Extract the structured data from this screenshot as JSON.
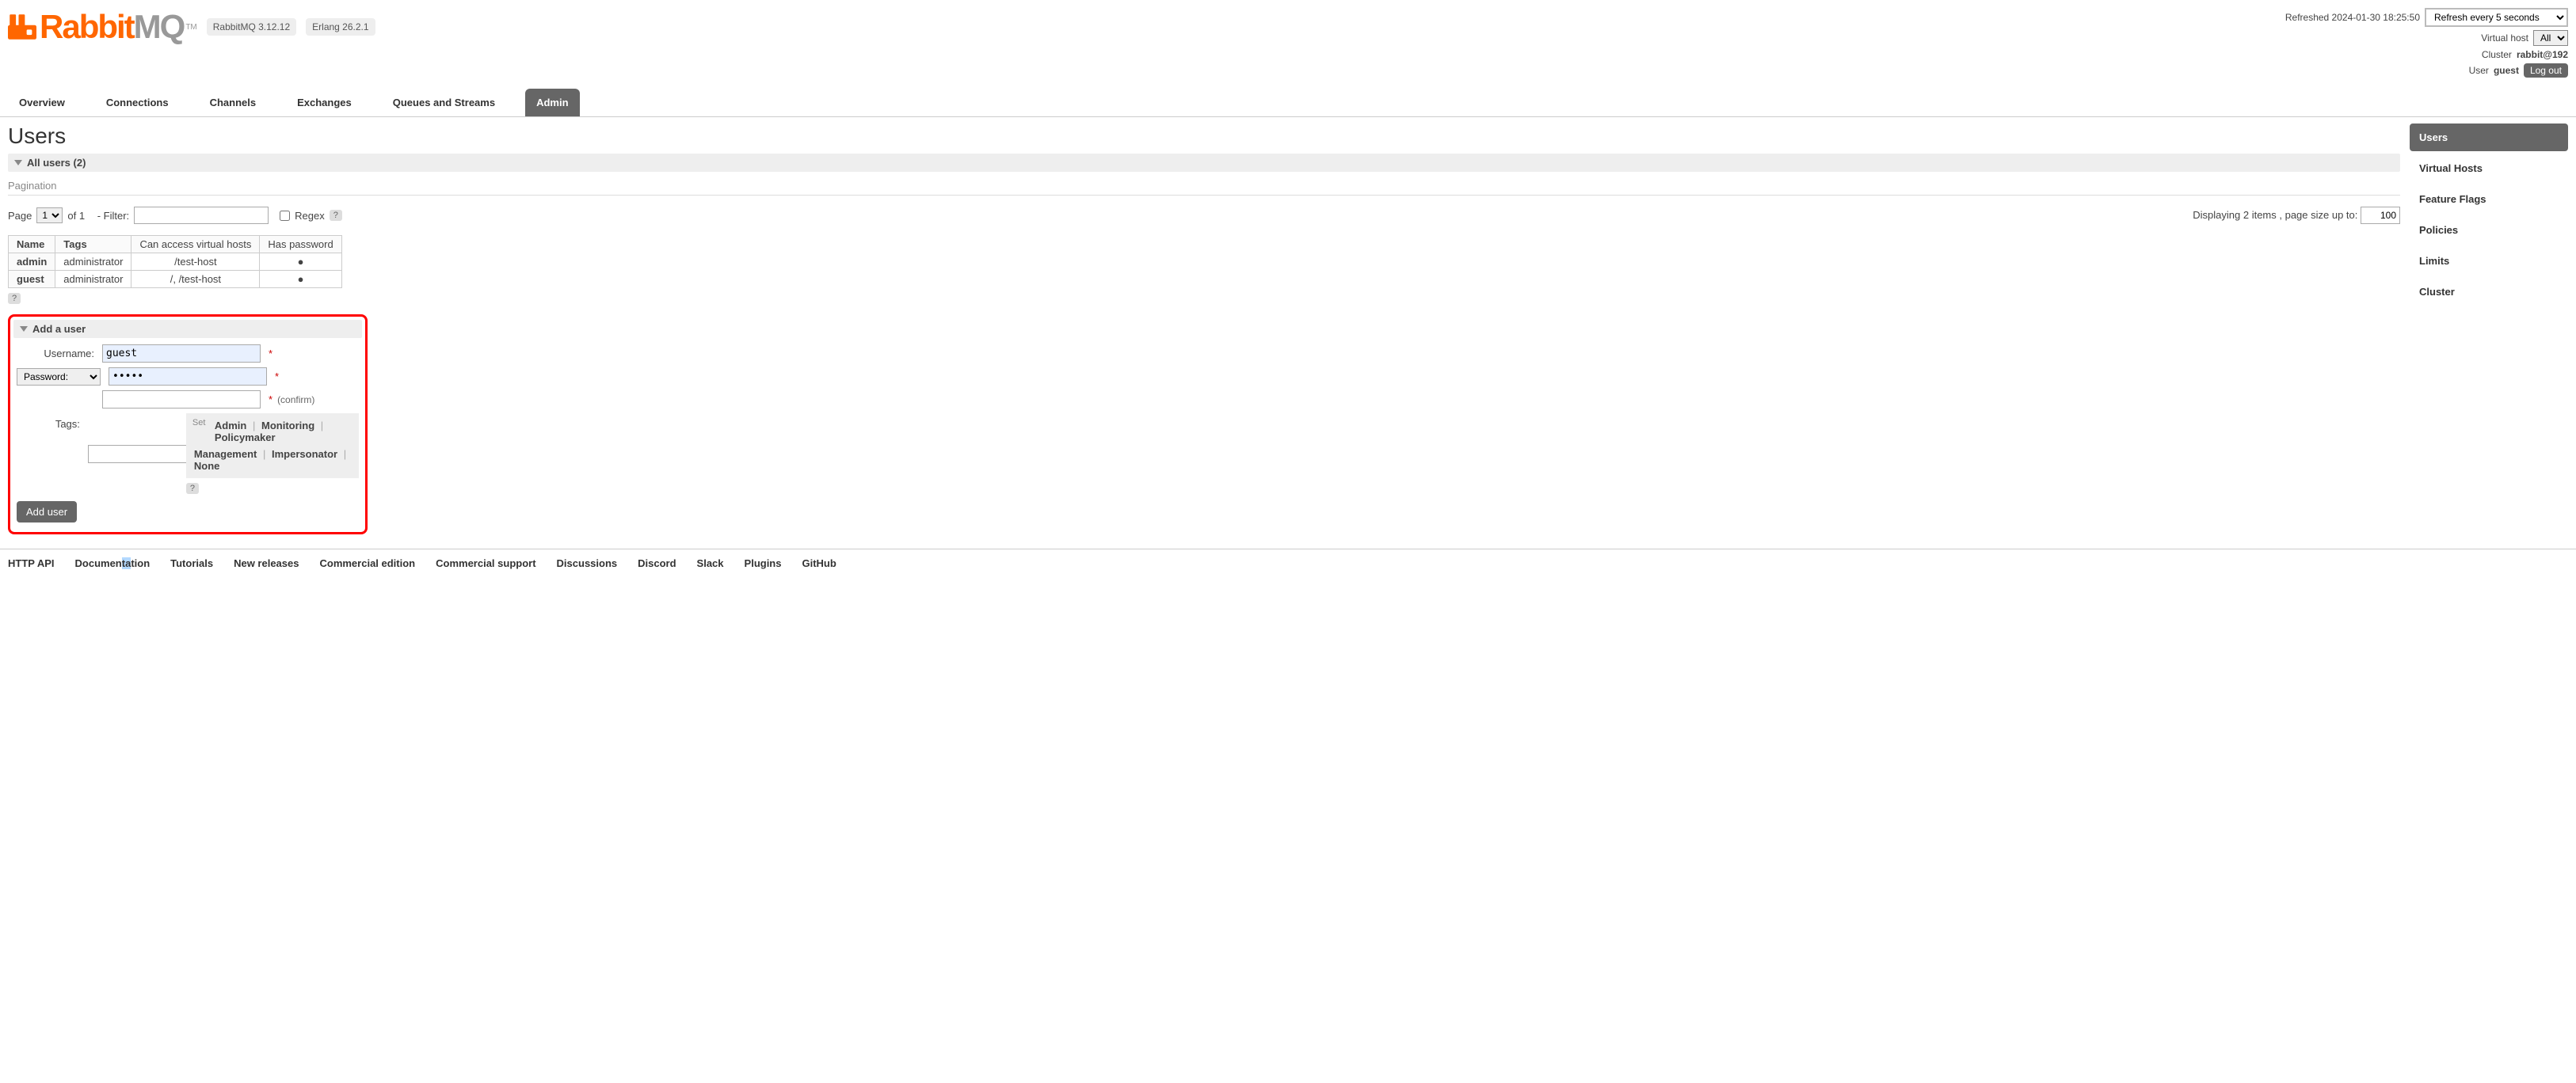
{
  "header": {
    "logo_rabbit": "Rabbit",
    "logo_mq": "MQ",
    "logo_tm": "TM",
    "version_rmq": "RabbitMQ 3.12.12",
    "version_erlang": "Erlang 26.2.1",
    "refreshed_label": "Refreshed 2024-01-30 18:25:50",
    "refresh_select": "Refresh every 5 seconds",
    "vhost_label": "Virtual host",
    "vhost_value": "All",
    "cluster_label": "Cluster",
    "cluster_value": "rabbit@192",
    "user_label": "User",
    "user_value": "guest",
    "logout": "Log out"
  },
  "nav": {
    "overview": "Overview",
    "connections": "Connections",
    "channels": "Channels",
    "exchanges": "Exchanges",
    "queues": "Queues and Streams",
    "admin": "Admin"
  },
  "page": {
    "title": "Users",
    "all_users": "All users (2)",
    "pagination_label": "Pagination",
    "page_label": "Page",
    "page_value": "1",
    "of_label": "of 1",
    "filter_label": "- Filter:",
    "regex_label": "Regex",
    "help": "?",
    "displaying": "Displaying 2 items , page size up to:",
    "pagesize": "100"
  },
  "table": {
    "headers": {
      "name": "Name",
      "tags": "Tags",
      "vhosts": "Can access virtual hosts",
      "password": "Has password"
    },
    "rows": [
      {
        "name": "admin",
        "tags": "administrator",
        "vhosts": "/test-host",
        "password": "●"
      },
      {
        "name": "guest",
        "tags": "administrator",
        "vhosts": "/, /test-host",
        "password": "●"
      }
    ]
  },
  "add_user": {
    "title": "Add a user",
    "username_label": "Username:",
    "username_value": "guest",
    "password_label": "Password:",
    "password_value": "•••••",
    "confirm_label": "(confirm)",
    "star": "*",
    "tags_label": "Tags:",
    "set_label": "Set",
    "tag_admin": "Admin",
    "tag_monitoring": "Monitoring",
    "tag_policymaker": "Policymaker",
    "tag_management": "Management",
    "tag_impersonator": "Impersonator",
    "tag_none": "None",
    "submit": "Add user"
  },
  "sidebar": {
    "users": "Users",
    "vhosts": "Virtual Hosts",
    "feature_flags": "Feature Flags",
    "policies": "Policies",
    "limits": "Limits",
    "cluster": "Cluster"
  },
  "footer": {
    "http_api": "HTTP API",
    "documentation_pre": "Documen",
    "documentation_hl": "ta",
    "documentation_post": "tion",
    "tutorials": "Tutorials",
    "new_releases": "New releases",
    "commercial_edition": "Commercial edition",
    "commercial_support": "Commercial support",
    "discussions": "Discussions",
    "discord": "Discord",
    "slack": "Slack",
    "plugins": "Plugins",
    "github": "GitHub"
  }
}
